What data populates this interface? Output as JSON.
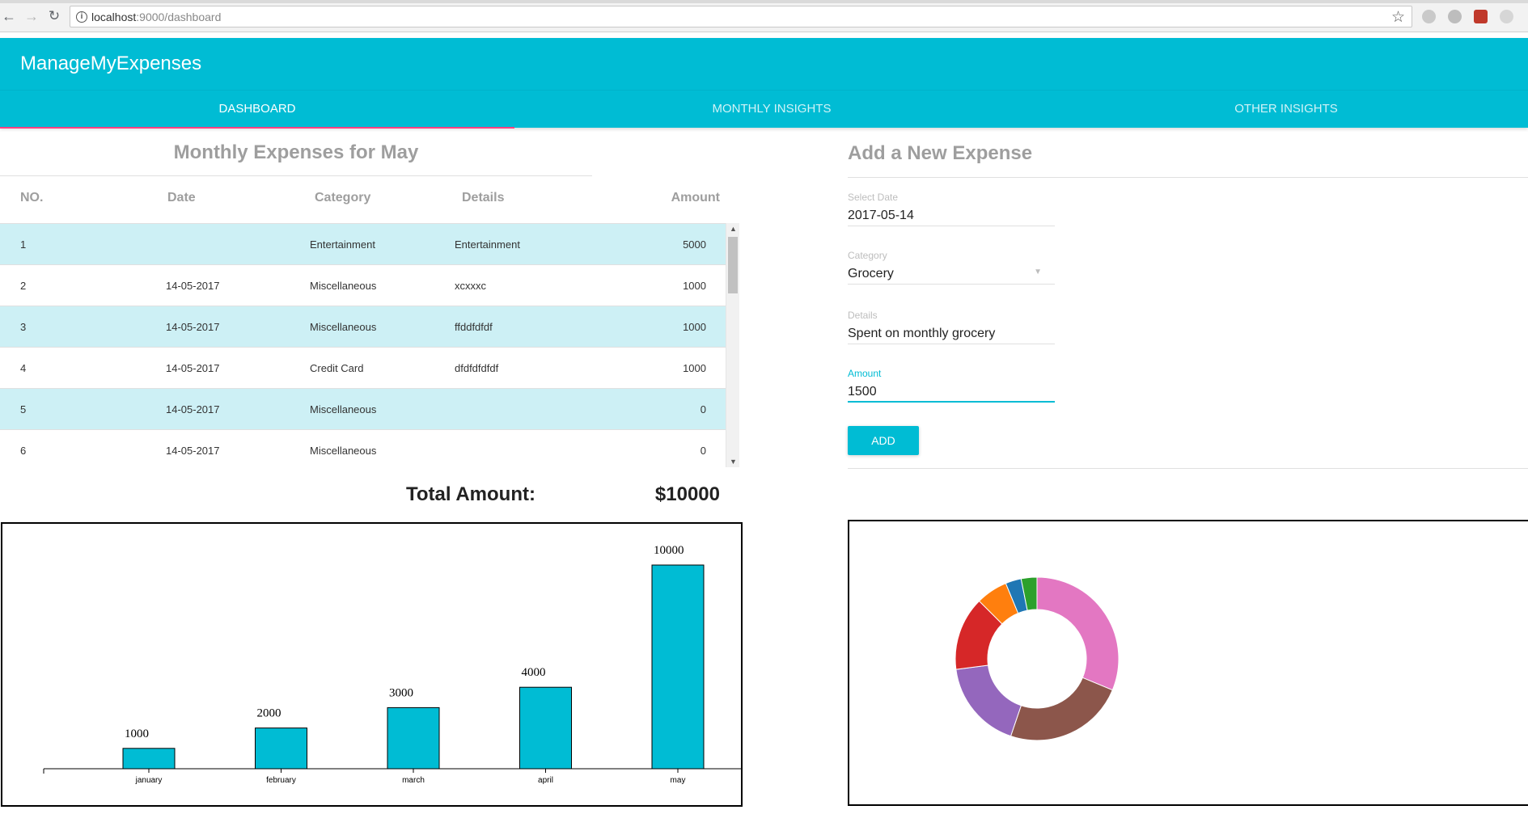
{
  "browser": {
    "url_host": "localhost",
    "url_rest": ":9000/dashboard"
  },
  "app": {
    "title": "ManageMyExpenses",
    "accent_color": "#00bcd4",
    "indicator_color": "#ff4081",
    "tabs": [
      {
        "label": "DASHBOARD",
        "active": true
      },
      {
        "label": "MONTHLY INSIGHTS",
        "active": false
      },
      {
        "label": "OTHER INSIGHTS",
        "active": false
      }
    ]
  },
  "expenses": {
    "title": "Monthly Expenses for May",
    "columns": {
      "no": "NO.",
      "date": "Date",
      "category": "Category",
      "details": "Details",
      "amount": "Amount"
    },
    "rows": [
      {
        "no": "1",
        "date": "",
        "category": "Entertainment",
        "details": "Entertainment",
        "amount": "5000"
      },
      {
        "no": "2",
        "date": "14-05-2017",
        "category": "Miscellaneous",
        "details": "xcxxxc",
        "amount": "1000"
      },
      {
        "no": "3",
        "date": "14-05-2017",
        "category": "Miscellaneous",
        "details": "ffddfdfdf",
        "amount": "1000"
      },
      {
        "no": "4",
        "date": "14-05-2017",
        "category": "Credit Card",
        "details": "dfdfdfdfdf",
        "amount": "1000"
      },
      {
        "no": "5",
        "date": "14-05-2017",
        "category": "Miscellaneous",
        "details": "",
        "amount": "0"
      },
      {
        "no": "6",
        "date": "14-05-2017",
        "category": "Miscellaneous",
        "details": "",
        "amount": "0"
      }
    ],
    "total_label": "Total Amount:",
    "total_value": "$10000"
  },
  "form": {
    "title": "Add a New Expense",
    "date_label": "Select Date",
    "date_value": "2017-05-14",
    "category_label": "Category",
    "category_value": "Grocery",
    "details_label": "Details",
    "details_value": "Spent on monthly grocery",
    "amount_label": "Amount",
    "amount_value": "1500",
    "add_label": "ADD"
  },
  "chart_data": [
    {
      "type": "bar",
      "categories": [
        "january",
        "february",
        "march",
        "april",
        "may"
      ],
      "values": [
        1000,
        2000,
        3000,
        4000,
        10000
      ],
      "ylim": [
        0,
        10000
      ],
      "bar_color": "#00bcd4",
      "data_labels": true,
      "grid": false
    },
    {
      "type": "pie",
      "donut": true,
      "values": [
        30,
        23,
        17,
        14,
        6,
        3,
        3
      ],
      "colors": [
        "#e377c2",
        "#8c564b",
        "#9467bd",
        "#d62728",
        "#ff7f0e",
        "#1f77b4",
        "#2ca02c"
      ]
    }
  ]
}
